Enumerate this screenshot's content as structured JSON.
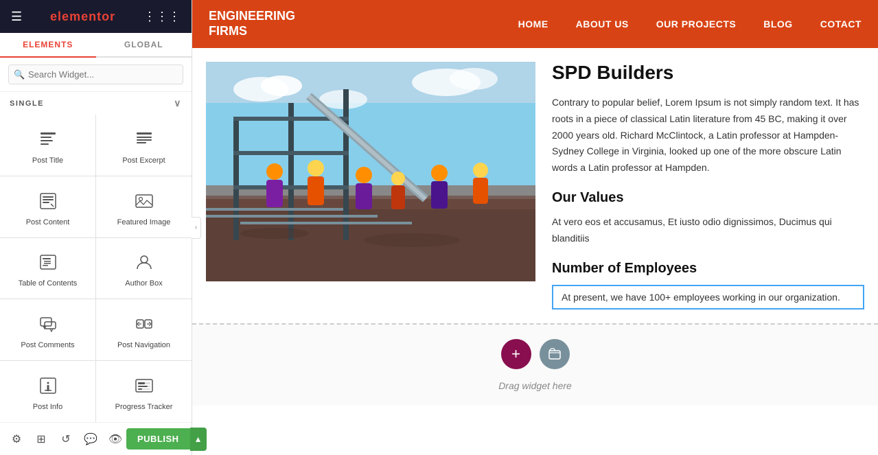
{
  "sidebar": {
    "brand": "elementor",
    "tabs": [
      {
        "label": "ELEMENTS",
        "active": true
      },
      {
        "label": "GLOBAL",
        "active": false
      }
    ],
    "search_placeholder": "Search Widget...",
    "category": "SINGLE",
    "widgets": [
      {
        "id": "post-title",
        "label": "Post Title",
        "icon": "doc-text"
      },
      {
        "id": "post-excerpt",
        "label": "Post Excerpt",
        "icon": "doc-lines"
      },
      {
        "id": "post-content",
        "label": "Post Content",
        "icon": "doc-edit"
      },
      {
        "id": "featured-image",
        "label": "Featured Image",
        "icon": "image-frame"
      },
      {
        "id": "table-of-contents",
        "label": "Table of Contents",
        "icon": "list-icon"
      },
      {
        "id": "author-box",
        "label": "Author Box",
        "icon": "person-circle"
      },
      {
        "id": "post-comments",
        "label": "Post Comments",
        "icon": "comments"
      },
      {
        "id": "post-navigation",
        "label": "Post Navigation",
        "icon": "nav-arrows"
      },
      {
        "id": "post-info",
        "label": "Post Info",
        "icon": "doc-dots"
      },
      {
        "id": "progress-tracker",
        "label": "Progress Tracker",
        "icon": "progress-bar"
      }
    ],
    "bottom_icons": [
      "settings",
      "layers",
      "history",
      "comments",
      "eye"
    ],
    "publish_label": "PUBLISH"
  },
  "topnav": {
    "brand_line1": "ENGINEERING",
    "brand_line2": "FIRMS",
    "links": [
      "HOME",
      "ABOUT US",
      "OUR PROJECTS",
      "BLOG",
      "COTACT"
    ]
  },
  "main": {
    "title": "SPD Builders",
    "body": "Contrary to popular belief, Lorem Ipsum is not simply random text. It has roots in a piece of classical Latin literature from 45 BC, making it over 2000 years old. Richard McClintock, a Latin professor at Hampden-Sydney College in Virginia, looked up one of the more obscure Latin words a Latin professor at Hampden.",
    "values_heading": "Our Values",
    "values_text": "At vero eos et accusamus, Et iusto odio dignissimos, Ducimus qui blanditiis",
    "employees_heading": "Number of Employees",
    "employees_text": "At present, we have 100+ employees working in our organization.",
    "drag_label": "Drag widget here",
    "plus_label": "+",
    "folder_label": "⊟"
  }
}
